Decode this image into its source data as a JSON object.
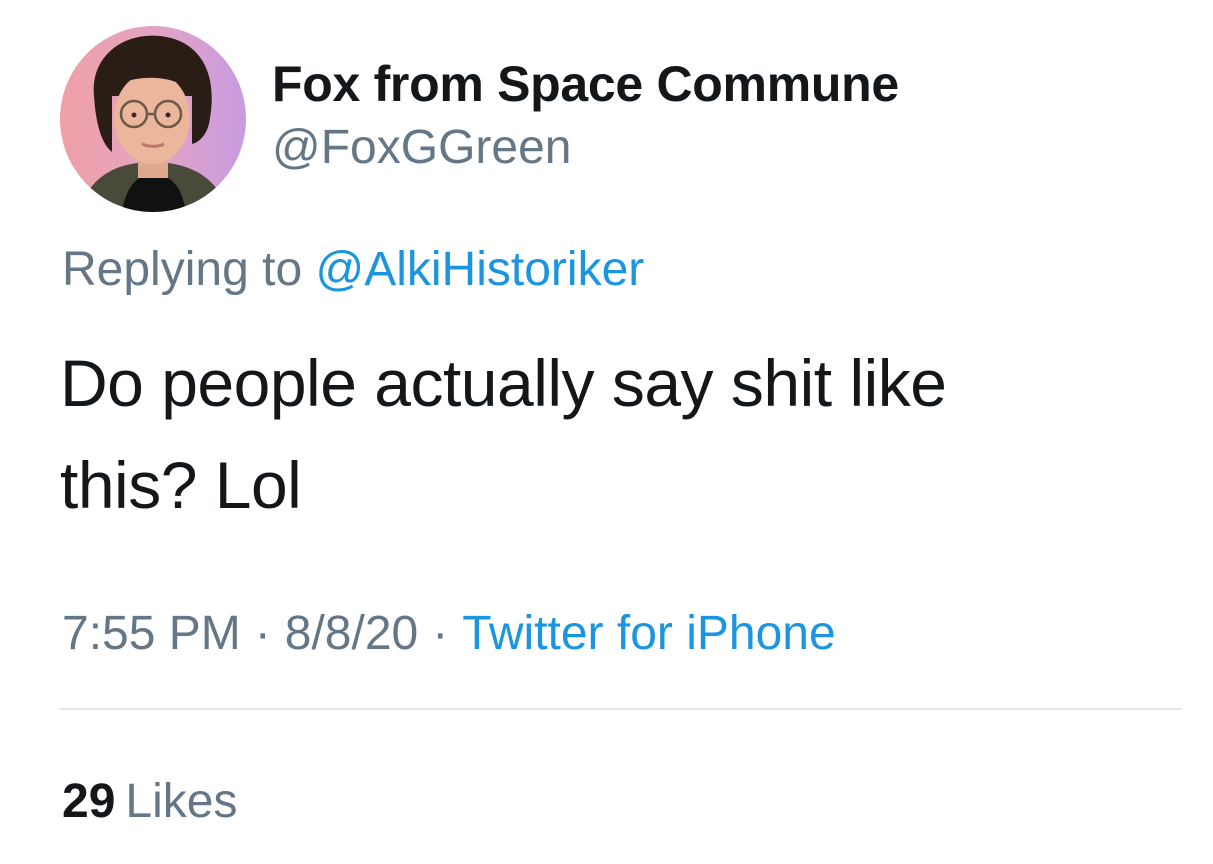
{
  "author": {
    "display_name": "Fox from Space Commune",
    "handle": "@FoxGGreen",
    "avatar_icon": "profile-photo"
  },
  "reply": {
    "prefix": "Replying to",
    "handle": "@AlkiHistoriker"
  },
  "tweet": {
    "text": "Do people actually say shit like this? Lol"
  },
  "meta": {
    "time": "7:55 PM",
    "separator": "·",
    "date": "8/8/20",
    "source": "Twitter for iPhone"
  },
  "stats": {
    "likes_count": "29",
    "likes_label": "Likes"
  },
  "colors": {
    "text_primary": "#14171a",
    "text_secondary": "#657786",
    "link": "#1b95e0",
    "divider": "#e1e8ed"
  }
}
